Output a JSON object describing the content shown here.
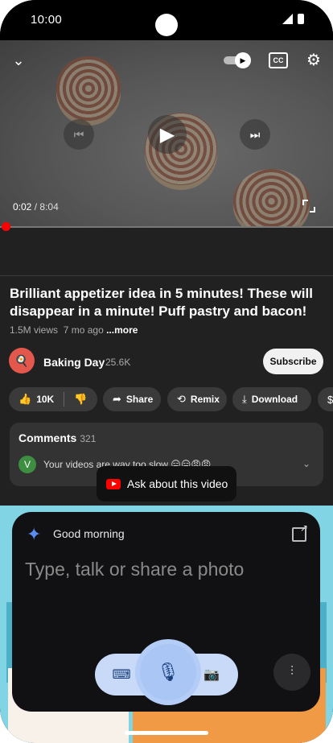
{
  "status_bar": {
    "time": "10:00"
  },
  "player": {
    "current_time": "0:02",
    "duration": "8:04",
    "separator": "/",
    "progress_fraction": 0.004,
    "icons": {
      "collapse": "chevron-down-icon",
      "autoplay": "autoplay-toggle-icon",
      "captions": "captions-icon",
      "settings": "gear-icon",
      "previous": "skip-previous-icon",
      "play": "play-icon",
      "next": "skip-next-icon",
      "fullscreen": "fullscreen-icon"
    },
    "captions_label": "CC"
  },
  "video": {
    "title": "Brilliant appetizer idea in 5 minutes! These will disappear in a minute! Puff pastry and bacon!",
    "views": "1.5M views",
    "age": "7 mo ago",
    "more_label": "...more"
  },
  "channel": {
    "name": "Baking Day",
    "subscribers": "25.6K",
    "subscribe_label": "Subscribe"
  },
  "actions": {
    "likes": "10K",
    "share": "Share",
    "remix": "Remix",
    "download": "Download"
  },
  "comments": {
    "heading": "Comments",
    "count": "321",
    "first_author_initial": "V",
    "first_comment": "Your videos are way too slow 😑😑😠😠"
  },
  "tooltip": {
    "text": "Ask about this video"
  },
  "assistant": {
    "greeting": "Good morning",
    "placeholder": "Type, talk or share a photo",
    "accent": "#5b8def"
  },
  "colors": {
    "background": "#212121",
    "progress": "#ff0000",
    "subscribe_bg": "#f1f1f1",
    "mic_accent": "#aac6f5"
  }
}
